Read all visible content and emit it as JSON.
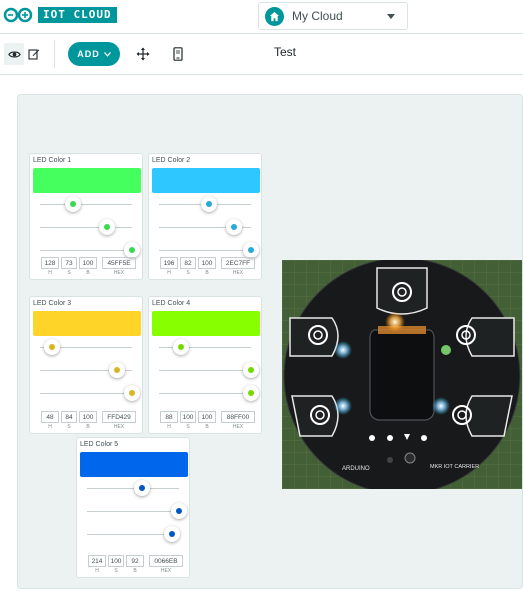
{
  "app": {
    "brand": "IOT CLOUD"
  },
  "thing_selector": {
    "value": "My Cloud",
    "icon": "home-icon"
  },
  "toolbar": {
    "view_icon": "eye-icon",
    "edit_icon": "edit-icon",
    "add_label": "ADD",
    "move_icon": "move-icon",
    "mobile_icon": "mobile-icon",
    "dashboard_title": "Test"
  },
  "colors": {
    "brand": "#00979c"
  },
  "widgets": [
    {
      "title": "LED Color 1",
      "h": "128",
      "s": "73",
      "b": "100",
      "hex": "45FF5E",
      "color": "#45ff5e",
      "h_frac": 0.356,
      "s_frac": 0.73,
      "b_frac": 1.0
    },
    {
      "title": "LED Color 2",
      "h": "196",
      "s": "82",
      "b": "100",
      "hex": "2EC7FF",
      "color": "#2ec7ff",
      "h_frac": 0.544,
      "s_frac": 0.82,
      "b_frac": 1.0
    },
    {
      "title": "LED Color 3",
      "h": "48",
      "s": "84",
      "b": "100",
      "hex": "FFD429",
      "color": "#ffd429",
      "h_frac": 0.133,
      "s_frac": 0.84,
      "b_frac": 1.0
    },
    {
      "title": "LED Color 4",
      "h": "88",
      "s": "100",
      "b": "100",
      "hex": "88FF00",
      "color": "#88ff00",
      "h_frac": 0.244,
      "s_frac": 1.0,
      "b_frac": 1.0
    },
    {
      "title": "LED Color 5",
      "h": "214",
      "s": "100",
      "b": "92",
      "hex": "0066EB",
      "color": "#0066eb",
      "h_frac": 0.594,
      "s_frac": 1.0,
      "b_frac": 0.92
    }
  ],
  "field_labels": {
    "h": "H",
    "s": "S",
    "b": "B",
    "hex": "HEX"
  },
  "photo": {
    "board_text_left": "ARDUINO",
    "board_text_right": "MKR IOT CARRIER"
  }
}
